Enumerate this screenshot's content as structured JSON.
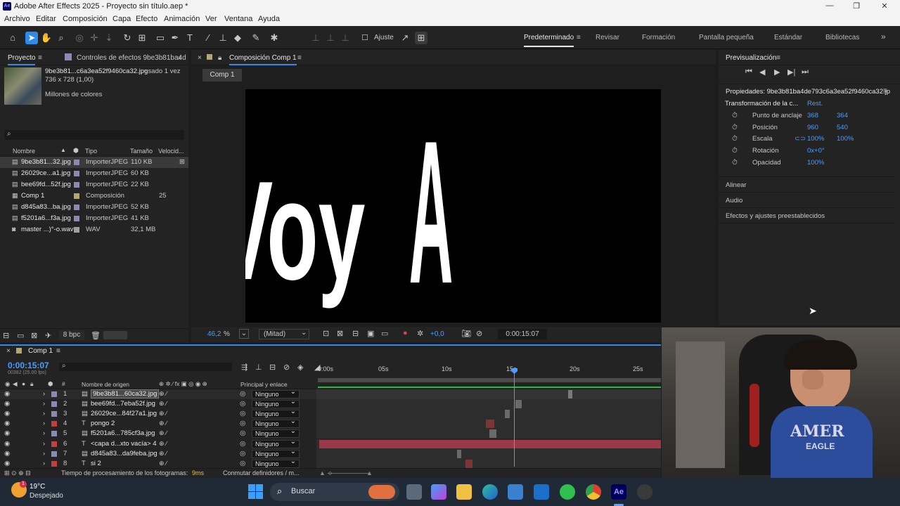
{
  "window": {
    "title": "Adobe After Effects 2025 - Proyecto sin título.aep *",
    "logo": "Ae",
    "minimize": "—",
    "maximize": "❐",
    "close": "✕"
  },
  "menu": [
    "Archivo",
    "Editar",
    "Composición",
    "Capa",
    "Efecto",
    "Animación",
    "Ver",
    "Ventana",
    "Ayuda"
  ],
  "toolbar": {
    "snap_label": "Ajuste",
    "workspaces": [
      "Predeterminado",
      "Revisar",
      "Formación",
      "Pantalla pequeña",
      "Estándar",
      "Bibliotecas"
    ],
    "more": "»"
  },
  "project": {
    "tab_project": "Proyecto",
    "tab_effects": "Controles de efectos 9be3b81ba4d",
    "selected_name": "9be3b81...c6a3ea52f9460ca32.jpg",
    "selected_usage": ", usado 1 vez",
    "selected_dims": "736 x 728 (1,00)",
    "selected_colors": "Millones de colores",
    "search_placeholder": "",
    "columns": {
      "name": "Nombre",
      "type": "Tipo",
      "size": "Tamaño",
      "speed": "Velocid..."
    },
    "items": [
      {
        "name": "9be3b81...32.jpg",
        "type": "ImporterJPEG",
        "size": "110 KB",
        "extra": "",
        "color": "#8a8ab4",
        "selected": true
      },
      {
        "name": "26029ce...a1.jpg",
        "type": "ImporterJPEG",
        "size": "60 KB",
        "extra": "",
        "color": "#8a8ab4",
        "selected": false
      },
      {
        "name": "bee69fd...52f.jpg",
        "type": "ImporterJPEG",
        "size": "22 KB",
        "extra": "",
        "color": "#8a8ab4",
        "selected": false
      },
      {
        "name": "Comp 1",
        "type": "Composición",
        "size": "",
        "extra": "25",
        "color": "#b4a870",
        "selected": false
      },
      {
        "name": "d845a83...ba.jpg",
        "type": "ImporterJPEG",
        "size": "52 KB",
        "extra": "",
        "color": "#8a8ab4",
        "selected": false
      },
      {
        "name": "f5201a6...f3a.jpg",
        "type": "ImporterJPEG",
        "size": "41 KB",
        "extra": "",
        "color": "#8a8ab4",
        "selected": false
      },
      {
        "name": "master ...)°-o.wav",
        "type": "WAV",
        "size": "32,1 MB",
        "extra": "",
        "color": "#a0a0a0",
        "selected": false
      }
    ],
    "bpc": "8 bpc"
  },
  "composition": {
    "tab": "Composición Comp 1",
    "subtab": "Comp 1",
    "canvas_text_left": "Voy",
    "canvas_text_right": "A",
    "zoom": "46,2",
    "zoom_unit": "%",
    "resolution": "(Mitad)",
    "exposure": "+0,0",
    "timecode": "0:00:15:07"
  },
  "preview": {
    "title": "Previsualización",
    "buttons": [
      "⏮",
      "◀",
      "▶",
      "▶|",
      "⏭"
    ]
  },
  "properties": {
    "title": "Propiedades: 9be3b81ba4de793c6a3ea52f9460ca32.jp",
    "section": "Transformación de la c...",
    "reset": "Rest.",
    "rows": [
      {
        "label": "Punto de anclaje",
        "v1": "368",
        "v2": "364"
      },
      {
        "label": "Posición",
        "v1": "960",
        "v2": "540"
      },
      {
        "label": "Escala",
        "v1": "100%",
        "v2": "100%"
      },
      {
        "label": "Rotación",
        "v1": "0x+0°",
        "v2": ""
      },
      {
        "label": "Opacidad",
        "v1": "100%",
        "v2": ""
      }
    ],
    "collapsed": [
      "Alinear",
      "Audio",
      "Efectos y ajustes preestablecidos"
    ]
  },
  "timeline": {
    "tab": "Comp 1",
    "timecode": "0:00:15:07",
    "frames": "00382 (25.00 fps)",
    "col_source": "Nombre de origen",
    "col_parent": "Principal y enlace",
    "ruler": [
      "0:00s",
      "05s",
      "10s",
      "15s",
      "20s",
      "25s"
    ],
    "layers": [
      {
        "num": "1",
        "kind": "img",
        "name": "9be3b81...60ca32.jpg",
        "color": "#8a8ab4",
        "parent": "Ninguno",
        "selected": true,
        "bar_start": 0.73,
        "bar_w": 0.012,
        "bar_color": "#7a7a7a"
      },
      {
        "num": "2",
        "kind": "img",
        "name": "bee69fd...7eba52f.jpg",
        "color": "#8a8ab4",
        "parent": "Ninguno",
        "selected": false,
        "bar_start": 0.575,
        "bar_w": 0.02,
        "bar_color": "#6a6a6a"
      },
      {
        "num": "3",
        "kind": "img",
        "name": "26029ce...84f27a1.jpg",
        "color": "#8a8ab4",
        "parent": "Ninguno",
        "selected": false,
        "bar_start": 0.545,
        "bar_w": 0.015,
        "bar_color": "#6a6a6a"
      },
      {
        "num": "4",
        "kind": "text",
        "name": "pongo 2",
        "color": "#c04040",
        "parent": "Ninguno",
        "selected": false,
        "bar_start": 0.49,
        "bar_w": 0.025,
        "bar_color": "#7a3535"
      },
      {
        "num": "5",
        "kind": "img",
        "name": "f5201a6...785cf3a.jpg",
        "color": "#8a8ab4",
        "parent": "Ninguno",
        "selected": false,
        "bar_start": 0.5,
        "bar_w": 0.02,
        "bar_color": "#6a6a6a"
      },
      {
        "num": "6",
        "kind": "text",
        "name": "<capa d...xto vacía> 4",
        "color": "#c04040",
        "parent": "Ninguno",
        "selected": false,
        "bar_start": 0.005,
        "bar_w": 0.995,
        "bar_color": "#9a3a48"
      },
      {
        "num": "7",
        "kind": "img",
        "name": "d845a83...da9feba.jpg",
        "color": "#8a8ab4",
        "parent": "Ninguno",
        "selected": false,
        "bar_start": 0.405,
        "bar_w": 0.012,
        "bar_color": "#6a6a6a"
      },
      {
        "num": "8",
        "kind": "text",
        "name": "si 2",
        "color": "#c04040",
        "parent": "Ninguno",
        "selected": false,
        "bar_start": 0.43,
        "bar_w": 0.02,
        "bar_color": "#7a3535"
      }
    ],
    "footer_render": "Tiempo de procesamiento de los fotogramas:",
    "footer_render_value": "9ms",
    "footer_toggle": "Conmutar definidores / m..."
  },
  "taskbar": {
    "weather_temp": "19°C",
    "weather_desc": "Despejado",
    "search_placeholder": "Buscar",
    "notif_badge": "1"
  },
  "webcam": {
    "shirt_text": "AMER",
    "shirt_sub": "EAGLE"
  }
}
